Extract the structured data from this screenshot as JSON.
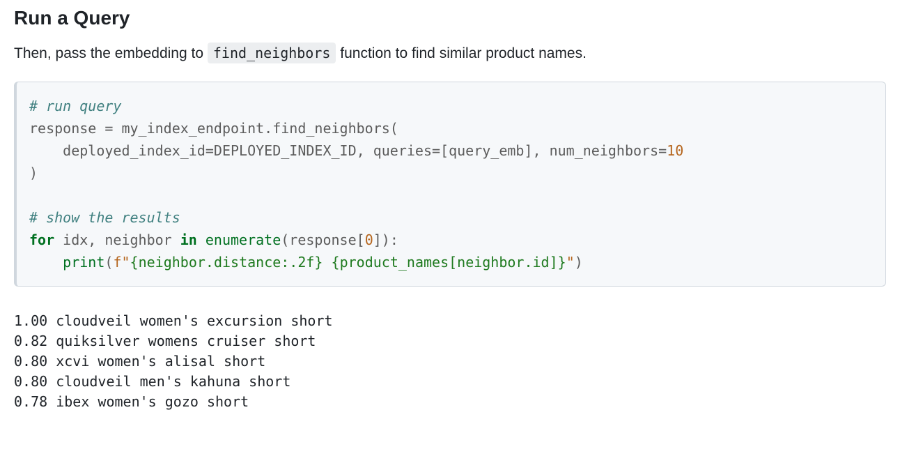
{
  "heading": "Run a Query",
  "intro": {
    "before": "Then, pass the embedding to ",
    "code": "find_neighbors",
    "after": " function to find similar product names."
  },
  "code": {
    "c1": "# run query",
    "l2_a": "response ",
    "l2_eq": "=",
    "l2_b": " my_index_endpoint",
    "l2_dot": ".",
    "l2_fn": "find_neighbors",
    "l2_op": "(",
    "l3_a": "    deployed_index_id",
    "l3_eq": "=",
    "l3_b": "DEPLOYED_INDEX_ID, queries",
    "l3_eq2": "=",
    "l3_c": "[query_emb], num_neighbors",
    "l3_eq3": "=",
    "l3_num": "10",
    "l4_cl": ")",
    "blank": "",
    "c2": "# show the results",
    "l7_for": "for",
    "l7_a": " idx, neighbor ",
    "l7_in": "in",
    "l7_sp": " ",
    "l7_enum": "enumerate",
    "l7_b": "(response[",
    "l7_zero": "0",
    "l7_c": "]):",
    "l8_ind": "    ",
    "l8_print": "print",
    "l8_op": "(",
    "l8_f": "f\"",
    "l8_br1": "{neighbor.distance:.2f}",
    "l8_sp": " ",
    "l8_br2": "{product_names[neighbor.id]}",
    "l8_q": "\"",
    "l8_cl": ")"
  },
  "output_lines": [
    "1.00 cloudveil women's excursion short",
    "0.82 quiksilver womens cruiser short",
    "0.80 xcvi women's alisal short",
    "0.80 cloudveil men's kahuna short",
    "0.78 ibex women's gozo short"
  ]
}
